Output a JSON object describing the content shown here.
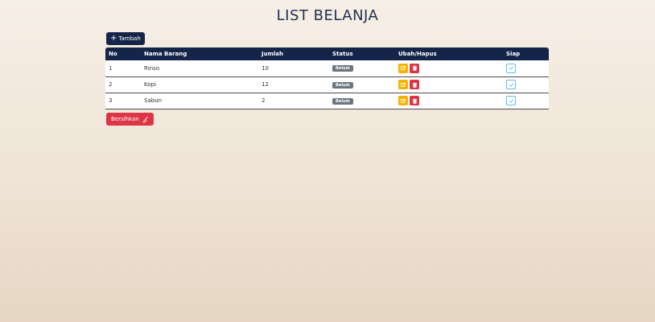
{
  "page": {
    "title": "LIST BELANJA"
  },
  "toolbar": {
    "add_label": "Tambah",
    "clear_label": "Bersihkan"
  },
  "table": {
    "headers": [
      "No",
      "Nama Barang",
      "Jumlah",
      "Status",
      "Ubah/Hapus",
      "Siap"
    ],
    "rows": [
      {
        "no": "1",
        "name": "Rinso",
        "qty": "10",
        "status": "Belum"
      },
      {
        "no": "2",
        "name": "Kopi",
        "qty": "12",
        "status": "Belum"
      },
      {
        "no": "3",
        "name": "Sabun",
        "qty": "2",
        "status": "Belum"
      }
    ]
  },
  "colors": {
    "primary": "#15254a",
    "edit": "#f4b400",
    "delete": "#dc3545",
    "check": "#5bc0de",
    "badge": "#6c757d"
  },
  "icons": {
    "add": "plus-icon",
    "edit": "pencil-square-icon",
    "delete": "trash-icon",
    "done": "check-icon",
    "clear": "broom-icon"
  }
}
